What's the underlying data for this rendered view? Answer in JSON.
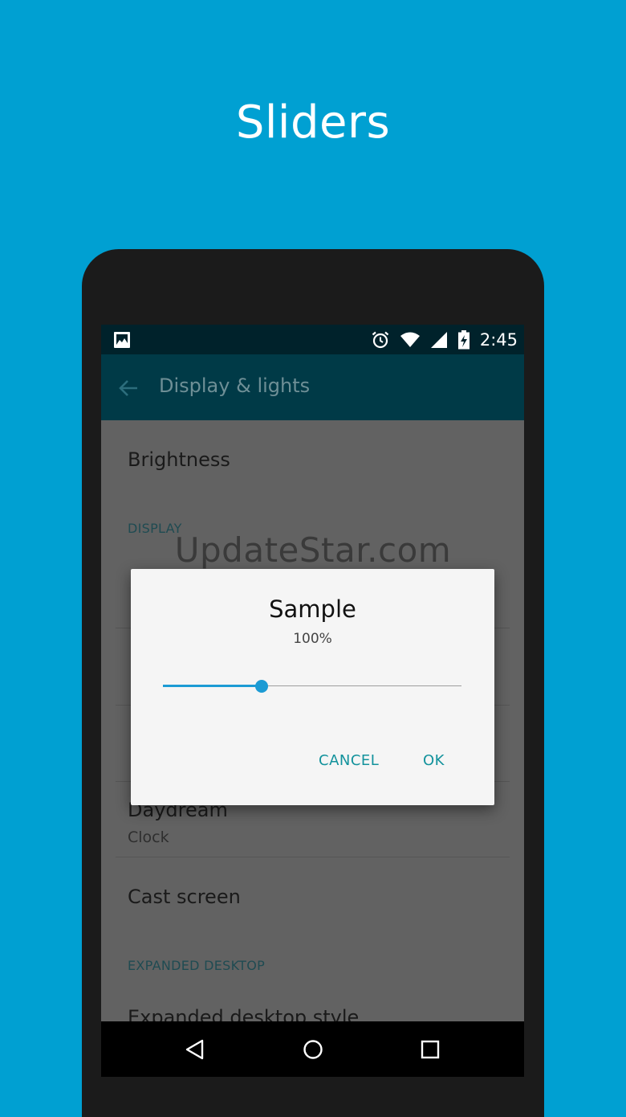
{
  "hero": {
    "title": "Sliders"
  },
  "status_bar": {
    "time": "2:45"
  },
  "toolbar": {
    "title": "Display & lights"
  },
  "list": {
    "brightness": "Brightness",
    "display_header": "DISPLAY",
    "daydream": {
      "title": "Daydream",
      "subtitle": "Clock"
    },
    "cast_screen": "Cast screen",
    "expanded_header": "EXPANDED DESKTOP",
    "expanded_style": "Expanded desktop style"
  },
  "watermark": "UpdateStar.com",
  "dialog": {
    "title": "Sample",
    "value_text": "100%",
    "slider_fraction": 0.33,
    "cancel_label": "CANCEL",
    "ok_label": "OK"
  },
  "colors": {
    "background": "#00a0d2",
    "toolbar": "#003a47",
    "status_bar": "#00222b",
    "accent": "#1c9bd4",
    "dialog_button": "#12929c"
  }
}
